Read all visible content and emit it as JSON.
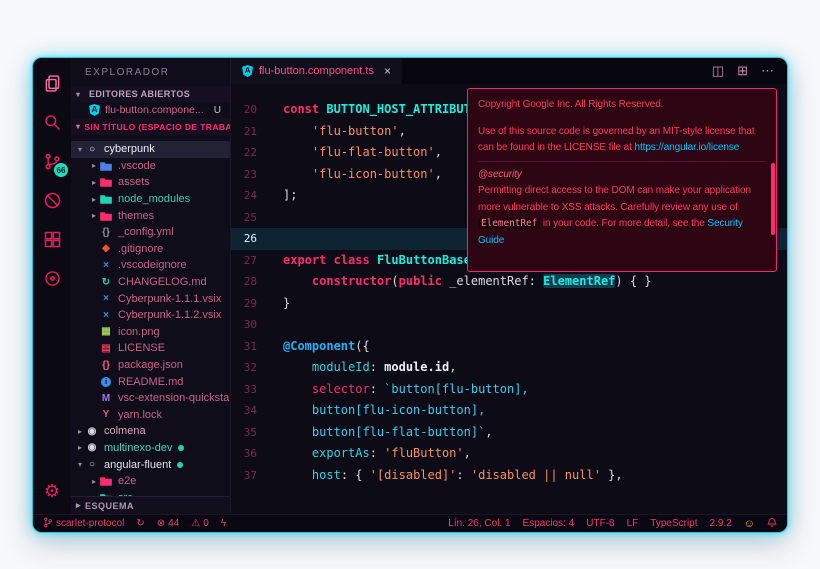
{
  "theme": {
    "accent_pink": "#ff2c6d",
    "accent_cyan": "#12f1e1",
    "link_blue": "#00c8ff",
    "window_bg": "#0d0b16",
    "tooltip_bg": "#2d0513",
    "tooltip_border": "#f0266f",
    "badge_teal": "#16e0c0",
    "glow_cyan": "#39e3ff"
  },
  "activity_bar": {
    "badge": "66"
  },
  "sidebar": {
    "title": "EXPLORADOR",
    "open_editors_label": "EDITORES ABIERTOS",
    "open_editor": {
      "label": "flu-button.compone...",
      "badge": "U"
    },
    "workspace_label": "SIN TÍTULO (ESPACIO DE TRABAJO)",
    "outline_label": "ESQUEMA",
    "tree": [
      {
        "label": "cyberpunk",
        "indent": 0,
        "arrow": "▾",
        "icon": "glyph",
        "glyph": "○",
        "color": "#e6e6f0",
        "text": "#ecedf5",
        "selected": true
      },
      {
        "label": ".vscode",
        "indent": 1,
        "arrow": "▸",
        "icon": "folder",
        "color": "#4f7fe8",
        "text": "#c9638c"
      },
      {
        "label": "assets",
        "indent": 1,
        "arrow": "▸",
        "icon": "folder",
        "color": "#ff2c6d",
        "text": "#c9638c"
      },
      {
        "label": "node_modules",
        "indent": 1,
        "arrow": "▸",
        "icon": "folder",
        "color": "#21d3b4",
        "text": "#3fcfb8"
      },
      {
        "label": "themes",
        "indent": 1,
        "arrow": "▸",
        "icon": "folder",
        "color": "#ff2c6d",
        "text": "#c9638c"
      },
      {
        "label": "_config.yml",
        "indent": 1,
        "arrow": "",
        "icon": "glyph",
        "glyph": "{}",
        "color": "#8f8fa2",
        "text": "#c9638c"
      },
      {
        "label": ".gitignore",
        "indent": 1,
        "arrow": "",
        "icon": "glyph",
        "glyph": "◆",
        "color": "#ef5133",
        "text": "#c9638c"
      },
      {
        "label": ".vscodeignore",
        "indent": 1,
        "arrow": "",
        "icon": "glyph",
        "glyph": "×",
        "color": "#3b8eea",
        "text": "#c9638c"
      },
      {
        "label": "CHANGELOG.md",
        "indent": 1,
        "arrow": "",
        "icon": "glyph",
        "glyph": "↻",
        "color": "#21d3b4",
        "text": "#c9638c"
      },
      {
        "label": "Cyberpunk-1.1.1.vsix",
        "indent": 1,
        "arrow": "",
        "icon": "glyph",
        "glyph": "×",
        "color": "#3b8eea",
        "text": "#c9638c"
      },
      {
        "label": "Cyberpunk-1.1.2.vsix",
        "indent": 1,
        "arrow": "",
        "icon": "glyph",
        "glyph": "×",
        "color": "#3b8eea",
        "text": "#c9638c"
      },
      {
        "label": "icon.png",
        "indent": 1,
        "arrow": "",
        "icon": "glyph",
        "glyph": "▦",
        "color": "#a3cf5f",
        "text": "#c9638c"
      },
      {
        "label": "LICENSE",
        "indent": 1,
        "arrow": "",
        "icon": "glyph",
        "glyph": "▤",
        "color": "#e83c5f",
        "text": "#c9638c"
      },
      {
        "label": "package.json",
        "indent": 1,
        "arrow": "",
        "icon": "glyph",
        "glyph": "{}",
        "color": "#ff5c8a",
        "text": "#c9638c"
      },
      {
        "label": "README.md",
        "indent": 1,
        "arrow": "",
        "icon": "circle",
        "glyph": "i",
        "color": "#3b8eea",
        "text": "#c9638c"
      },
      {
        "label": "vsc-extension-quicksta...",
        "indent": 1,
        "arrow": "",
        "icon": "glyph",
        "glyph": "M",
        "color": "#a479e6",
        "text": "#c9638c"
      },
      {
        "label": "yarn.lock",
        "indent": 1,
        "arrow": "",
        "icon": "glyph",
        "glyph": "Y",
        "color": "#e85c7a",
        "text": "#c9638c"
      },
      {
        "label": "colmena",
        "indent": 0,
        "arrow": "▸",
        "icon": "glyph",
        "glyph": "◉",
        "color": "#d9d9e4",
        "text": "#d8a9bd"
      },
      {
        "label": "multinexo-dev",
        "indent": 0,
        "arrow": "▸",
        "icon": "glyph",
        "glyph": "◉",
        "color": "#d9d9e4",
        "text": "#4fd2c2",
        "dot": true
      },
      {
        "label": "angular-fluent",
        "indent": 0,
        "arrow": "▾",
        "icon": "glyph",
        "glyph": "○",
        "color": "#d9d9e4",
        "text": "#e3e4ee",
        "dot": true
      },
      {
        "label": "e2e",
        "indent": 1,
        "arrow": "▸",
        "icon": "folder",
        "color": "#ff2c6d",
        "text": "#c9638c"
      },
      {
        "label": "src",
        "indent": 1,
        "arrow": "▸",
        "icon": "folder",
        "color": "#21d3b4",
        "text": "#3fcfb8"
      }
    ]
  },
  "editor": {
    "tab": {
      "label": "flu-button.component.ts",
      "close": "×"
    },
    "actions": [
      {
        "name": "split-editor",
        "glyph": "◫"
      },
      {
        "name": "toggle-layout",
        "glyph": "⊞"
      },
      {
        "name": "more-actions",
        "glyph": "⋯"
      }
    ],
    "code": {
      "lines": [
        {
          "num": 20,
          "segs": [
            [
              "kw",
              "const"
            ],
            [
              "pl",
              " "
            ],
            [
              "cn",
              "BUTTON_HOST_ATTRIBUTES"
            ]
          ]
        },
        {
          "num": 21,
          "segs": [
            [
              "pl",
              "    "
            ],
            [
              "str",
              "'flu-button'"
            ],
            [
              "pl",
              ","
            ]
          ]
        },
        {
          "num": 22,
          "segs": [
            [
              "pl",
              "    "
            ],
            [
              "str",
              "'flu-flat-button'"
            ],
            [
              "pl",
              ","
            ]
          ]
        },
        {
          "num": 23,
          "segs": [
            [
              "pl",
              "    "
            ],
            [
              "str",
              "'flu-icon-button'"
            ],
            [
              "pl",
              ","
            ]
          ]
        },
        {
          "num": 24,
          "segs": [
            [
              "pl",
              "];"
            ]
          ]
        },
        {
          "num": 25,
          "segs": []
        },
        {
          "num": 26,
          "segs": [],
          "cur": true
        },
        {
          "num": 27,
          "segs": [
            [
              "kw",
              "export"
            ],
            [
              "pl",
              " "
            ],
            [
              "kw",
              "class"
            ],
            [
              "pl",
              " "
            ],
            [
              "cn",
              "FluButtonBase"
            ],
            [
              "pl",
              " {"
            ]
          ]
        },
        {
          "num": 28,
          "segs": [
            [
              "pl",
              "    "
            ],
            [
              "kw",
              "constructor"
            ],
            [
              "pl",
              "("
            ],
            [
              "kw",
              "public"
            ],
            [
              "pl",
              " _elementRef: "
            ],
            [
              "cnh",
              "ElementRef"
            ],
            [
              "pl",
              ") { }"
            ]
          ]
        },
        {
          "num": 29,
          "segs": [
            [
              "pl",
              "}"
            ]
          ]
        },
        {
          "num": 30,
          "segs": []
        },
        {
          "num": 31,
          "segs": [
            [
              "dec",
              "@Component"
            ],
            [
              "pl",
              "({"
            ]
          ]
        },
        {
          "num": 32,
          "segs": [
            [
              "pl",
              "    "
            ],
            [
              "key",
              "moduleId"
            ],
            [
              "pl",
              ": "
            ],
            [
              "bold",
              "module.id"
            ],
            [
              "pl",
              ","
            ]
          ]
        },
        {
          "num": 33,
          "segs": [
            [
              "pl",
              "    "
            ],
            [
              "keyr",
              "selector"
            ],
            [
              "pl",
              ": "
            ],
            [
              "tpl",
              "`button[flu-button],"
            ]
          ]
        },
        {
          "num": 34,
          "segs": [
            [
              "pl",
              "    "
            ],
            [
              "tpl",
              "button[flu-icon-button],"
            ]
          ]
        },
        {
          "num": 35,
          "segs": [
            [
              "pl",
              "    "
            ],
            [
              "tpl",
              "button[flu-flat-button]`"
            ],
            [
              "pl",
              ","
            ]
          ]
        },
        {
          "num": 36,
          "segs": [
            [
              "pl",
              "    "
            ],
            [
              "key",
              "exportAs"
            ],
            [
              "pl",
              ": "
            ],
            [
              "str",
              "'fluButton'"
            ],
            [
              "pl",
              ","
            ]
          ]
        },
        {
          "num": 37,
          "segs": [
            [
              "pl",
              "    "
            ],
            [
              "key",
              "host"
            ],
            [
              "pl",
              ": { "
            ],
            [
              "str",
              "'[disabled]'"
            ],
            [
              "pl",
              ": "
            ],
            [
              "str",
              "'disabled || null'"
            ],
            [
              "pl",
              " },"
            ]
          ]
        }
      ]
    }
  },
  "tooltip": {
    "lines": [
      {
        "segs": [
          [
            "t",
            "Copyright Google Inc. All Rights Reserved."
          ]
        ]
      },
      {
        "blank": true
      },
      {
        "segs": [
          [
            "t",
            "Use of this source code is governed by an MIT-style license that"
          ]
        ]
      },
      {
        "segs": [
          [
            "t",
            "can be found in the LICENSE file at "
          ],
          [
            "link",
            "https://angular.io/license"
          ]
        ]
      },
      {
        "hr": true
      },
      {
        "segs": [
          [
            "em",
            "@security"
          ]
        ]
      },
      {
        "segs": [
          [
            "t",
            "Permitting direct access to the DOM can make your application"
          ]
        ]
      },
      {
        "segs": [
          [
            "t",
            "more vulnerable to XSS attacks. Carefully review any use of"
          ]
        ]
      },
      {
        "segs": [
          [
            "code",
            "ElementRef"
          ],
          [
            "t",
            " in your code. For more detail, see the "
          ],
          [
            "link",
            "Security"
          ]
        ]
      },
      {
        "segs": [
          [
            "link",
            "Guide"
          ]
        ]
      }
    ]
  },
  "status_bar": {
    "left": [
      {
        "icon": "branch",
        "label": "scarlet-protocol"
      },
      {
        "icon": "sync",
        "label": ""
      },
      {
        "icon": "error",
        "label": "44"
      },
      {
        "icon": "warning",
        "label": "0"
      },
      {
        "icon": "bolt",
        "label": ""
      }
    ],
    "right": [
      {
        "label": "Lín. 26, Col. 1"
      },
      {
        "label": "Espacios: 4"
      },
      {
        "label": "UTF-8"
      },
      {
        "label": "LF"
      },
      {
        "label": "TypeScript"
      },
      {
        "label": "2.9.2"
      },
      {
        "icon": "smiley",
        "label": ""
      },
      {
        "icon": "bell",
        "label": ""
      }
    ]
  }
}
